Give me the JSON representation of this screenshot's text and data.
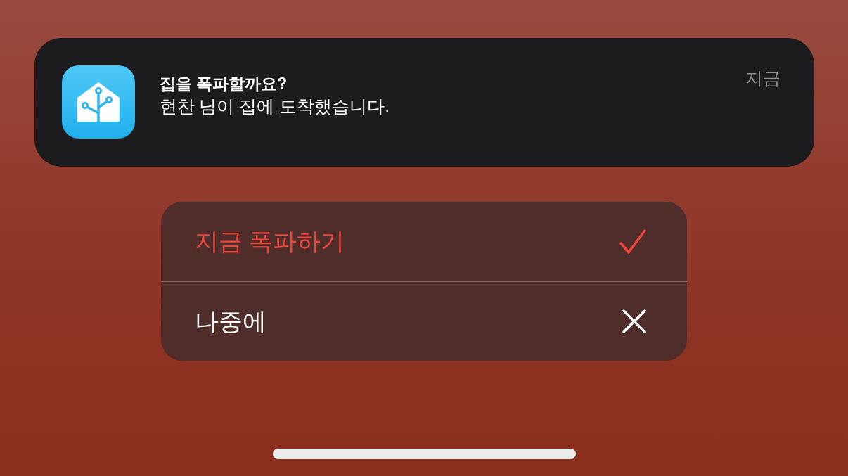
{
  "notification": {
    "title": "집을 폭파할까요?",
    "body": "현찬 님이 집에 도착했습니다.",
    "time": "지금"
  },
  "actions": [
    {
      "label": "지금 폭파하기",
      "kind": "destructive"
    },
    {
      "label": "나중에",
      "kind": "cancel"
    }
  ]
}
